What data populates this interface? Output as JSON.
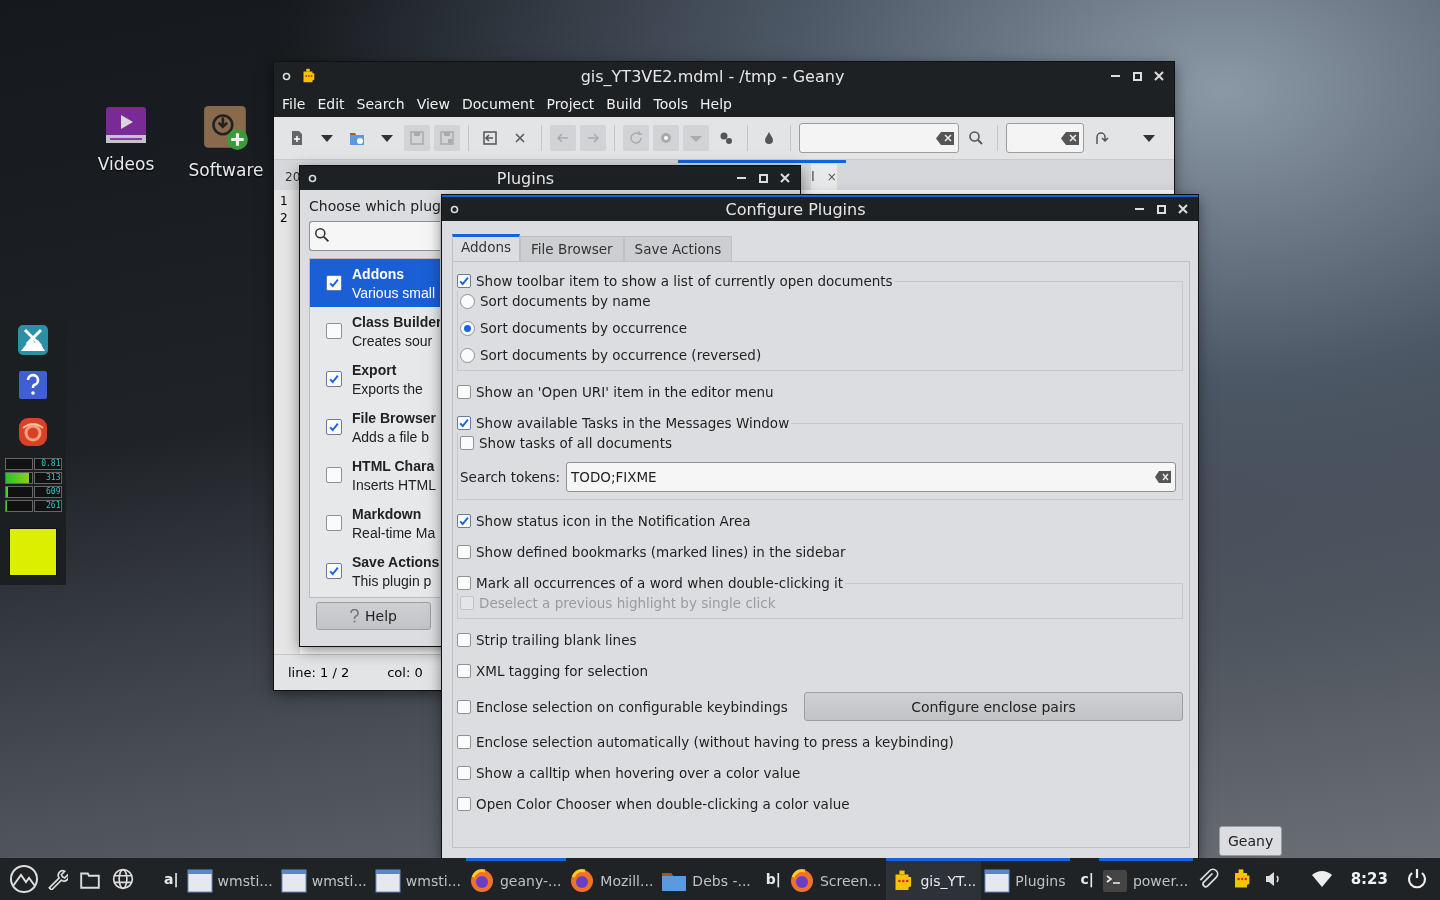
{
  "desktop_icons": [
    {
      "label": "Videos",
      "kind": "videos"
    },
    {
      "label": "Software",
      "kind": "software"
    }
  ],
  "monitor": [
    {
      "reading": "0.81",
      "level": 0.02
    },
    {
      "reading": "313",
      "level": 0.9
    },
    {
      "reading": "609",
      "level": 0.1
    },
    {
      "reading": "261",
      "level": 0.06
    }
  ],
  "geany": {
    "title": "gis_YT3VE2.mdml - /tmp - Geany",
    "menu": [
      "File",
      "Edit",
      "Search",
      "View",
      "Document",
      "Project",
      "Build",
      "Tools",
      "Help"
    ],
    "tabs": [
      {
        "label": "20",
        "selected": false
      },
      {
        "label": "l",
        "close": "×",
        "selected": true
      }
    ],
    "line_numbers": [
      "1",
      "2"
    ],
    "status_line": "line: 1 / 2",
    "status_col": "col: 0"
  },
  "plugins_dialog": {
    "title": "Plugins",
    "prompt": "Choose which plug",
    "plugins": [
      {
        "name": "Addons",
        "description": "Various small",
        "checked": true,
        "selected": true
      },
      {
        "name": "Class Builder",
        "description": "Creates sour",
        "checked": false,
        "selected": false
      },
      {
        "name": "Export",
        "description": "Exports the",
        "checked": true,
        "selected": false
      },
      {
        "name": "File Browser",
        "description": "Adds a file b",
        "checked": true,
        "selected": false
      },
      {
        "name": "HTML Chara",
        "description": "Inserts HTML",
        "checked": false,
        "selected": false
      },
      {
        "name": "Markdown",
        "description": "Real-time Ma",
        "checked": false,
        "selected": false
      },
      {
        "name": "Save Actions",
        "description": "This plugin p",
        "checked": true,
        "selected": false
      }
    ],
    "help_button": "Help"
  },
  "configure_dialog": {
    "title": "Configure Plugins",
    "tabs": [
      {
        "label": "Addons",
        "selected": true
      },
      {
        "label": "File Browser",
        "selected": false
      },
      {
        "label": "Save Actions",
        "selected": false
      }
    ],
    "options": [
      {
        "kind": "check",
        "label": "Show toolbar item to show a list of currently open documents",
        "checked": true,
        "disabled": false,
        "children": [
          {
            "kind": "radio",
            "label": "Sort documents by name",
            "selected": false
          },
          {
            "kind": "radio",
            "label": "Sort documents by occurrence",
            "selected": true
          },
          {
            "kind": "radio",
            "label": "Sort documents by occurrence (reversed)",
            "selected": false
          }
        ]
      },
      {
        "kind": "check",
        "label": "Show an 'Open URI' item in the editor menu",
        "checked": false,
        "disabled": false
      },
      {
        "kind": "check",
        "label": "Show available Tasks in the Messages Window",
        "checked": true,
        "disabled": false,
        "children": [
          {
            "kind": "check",
            "label": "Show tasks of all documents",
            "checked": false,
            "disabled": false
          },
          {
            "kind": "field",
            "label": "Search tokens:",
            "value": "TODO;FIXME"
          }
        ]
      },
      {
        "kind": "check",
        "label": "Show status icon in the Notification Area",
        "checked": true,
        "disabled": false
      },
      {
        "kind": "check",
        "label": "Show defined bookmarks (marked lines) in the sidebar",
        "checked": false,
        "disabled": false
      },
      {
        "kind": "check",
        "label": "Mark all occurrences of a word when double-clicking it",
        "checked": false,
        "disabled": false,
        "children": [
          {
            "kind": "check",
            "label": "Deselect a previous highlight by single click",
            "checked": false,
            "disabled": true
          }
        ]
      },
      {
        "kind": "check",
        "label": "Strip trailing blank lines",
        "checked": false,
        "disabled": false
      },
      {
        "kind": "check",
        "label": "XML tagging for selection",
        "checked": false,
        "disabled": false
      },
      {
        "kind": "check",
        "label": "Enclose selection on configurable keybindings",
        "checked": false,
        "disabled": false,
        "button": "Configure enclose pairs"
      },
      {
        "kind": "check",
        "label": "Enclose selection automatically (without having to press a keybinding)",
        "checked": false,
        "disabled": false
      },
      {
        "kind": "check",
        "label": "Show a calltip when hovering over a color value",
        "checked": false,
        "disabled": false
      },
      {
        "kind": "check",
        "label": "Open Color Chooser when double-clicking a color value",
        "checked": false,
        "disabled": false
      }
    ]
  },
  "taskbar": {
    "launchers": [
      {
        "kind": "start"
      },
      {
        "kind": "wrench"
      },
      {
        "kind": "folder"
      },
      {
        "kind": "globe"
      }
    ],
    "items": [
      {
        "kind": "workspace",
        "label": "a|"
      },
      {
        "kind": "blank-window",
        "label": "wmsti...",
        "selected": false,
        "indicator": false
      },
      {
        "kind": "blank-window",
        "label": "wmsti...",
        "selected": false,
        "indicator": false
      },
      {
        "kind": "blank-window",
        "label": "wmsti...",
        "selected": false,
        "indicator": false
      },
      {
        "kind": "firefox",
        "label": "geany-...",
        "selected": false,
        "indicator": true
      },
      {
        "kind": "firefox",
        "label": "Mozill...",
        "selected": false,
        "indicator": false
      },
      {
        "kind": "folder",
        "label": "Debs -...",
        "selected": false,
        "indicator": false
      },
      {
        "kind": "workspace",
        "label": "b|"
      },
      {
        "kind": "firefox",
        "label": "Screen...",
        "selected": false,
        "indicator": false
      },
      {
        "kind": "geany",
        "label": "gis_YT...",
        "selected": true,
        "indicator": true
      },
      {
        "kind": "blank-window",
        "label": "Plugins",
        "selected": false,
        "indicator": true
      },
      {
        "kind": "workspace",
        "label": "c|"
      },
      {
        "kind": "terminal",
        "label": "power...",
        "selected": false,
        "indicator": true
      }
    ],
    "clock": "8:23"
  },
  "tooltip": "Geany"
}
